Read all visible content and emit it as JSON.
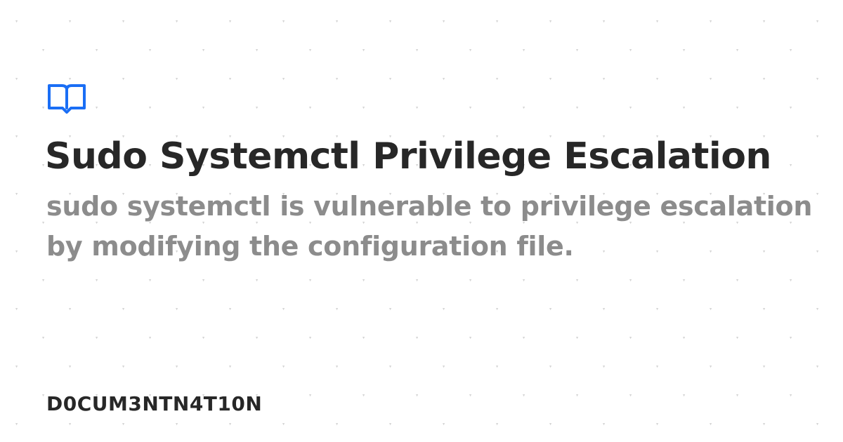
{
  "page": {
    "title": "Sudo Systemctl Privilege Escalation",
    "description": "sudo systemctl is vulnerable to privilege escalation by modifying the configuration file.",
    "brand": "D0CUM3NTN4T10N"
  },
  "logo": {
    "icon": "book-open-icon",
    "color": "#1a6ef5"
  },
  "colors": {
    "background": "#ffffff",
    "title": "#272727",
    "description": "#8c8c8c",
    "dots": "#d4d4d4"
  }
}
